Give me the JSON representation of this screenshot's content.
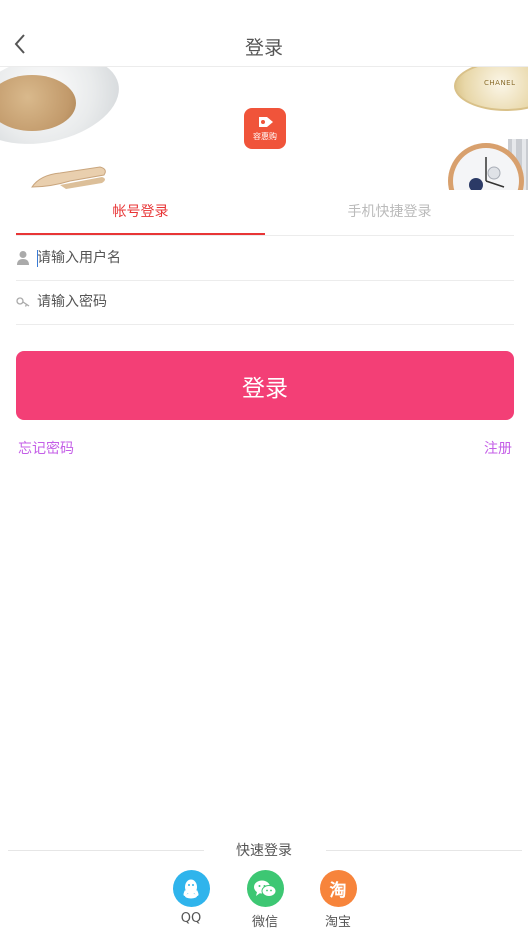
{
  "header": {
    "title": "登录",
    "back_icon": "chevron-left-icon"
  },
  "banner": {
    "app_logo_text": "容惠购",
    "perfume_brand": "CHANEL"
  },
  "tabs": [
    {
      "label": "帐号登录",
      "active": true
    },
    {
      "label": "手机快捷登录",
      "active": false
    }
  ],
  "form": {
    "username": {
      "placeholder": "请输入用户名",
      "value": "",
      "icon": "user-icon"
    },
    "password": {
      "placeholder": "请输入密码",
      "value": "",
      "icon": "key-icon"
    },
    "login_label": "登录",
    "forgot_label": "忘记密码",
    "register_label": "注册"
  },
  "quick_login": {
    "title": "快速登录",
    "items": [
      {
        "label": "QQ",
        "icon": "qq-icon"
      },
      {
        "label": "微信",
        "icon": "wechat-icon"
      },
      {
        "label": "淘宝",
        "icon": "taobao-icon",
        "glyph": "淘"
      }
    ]
  },
  "colors": {
    "accent_red": "#e83536",
    "login_button": "#f33f76",
    "link_purple": "#c45ee7",
    "qq_blue": "#2fb4ec",
    "wechat_green": "#3dc773",
    "taobao_orange": "#f7843b"
  }
}
